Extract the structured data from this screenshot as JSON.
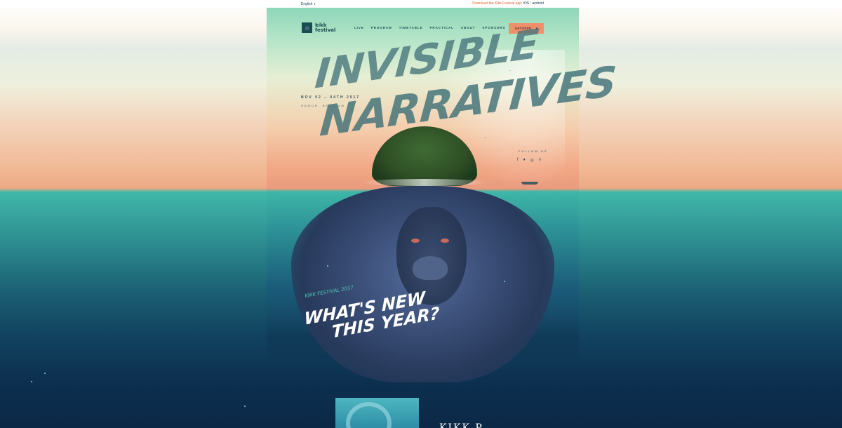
{
  "topbar": {
    "language": "English",
    "app_text": "Download the Kikk Festival app:",
    "ios": "iOS",
    "separator": "/",
    "android": "android"
  },
  "logo": {
    "line1": "kikk",
    "line2": "festival"
  },
  "nav": {
    "items": [
      "LIVE",
      "PROGRAM",
      "TIMETABLE",
      "PRACTICAL",
      "ABOUT",
      "SPONSORS"
    ],
    "cta": "Get tickets"
  },
  "hero": {
    "title_line1": "INVISIBLE",
    "title_line2": "NARRATIVES",
    "dates": "NOV 02 – 04TH 2017",
    "location": "NAMUR, BELGIUM",
    "follow_label": "FOLLOW US",
    "social_icons": [
      "facebook-icon",
      "twitter-icon",
      "instagram-icon",
      "vimeo-icon"
    ]
  },
  "whats_new": {
    "kicker": "KIKK FESTIVAL 2017",
    "line1": "WHAT'S NEW",
    "line2": "THIS YEAR?"
  },
  "section": {
    "heading": "KIKK P"
  },
  "colors": {
    "accent": "#f28f6b",
    "brand": "#1b4b54",
    "teal": "#4ec7b2",
    "deep": "#0b2846"
  }
}
